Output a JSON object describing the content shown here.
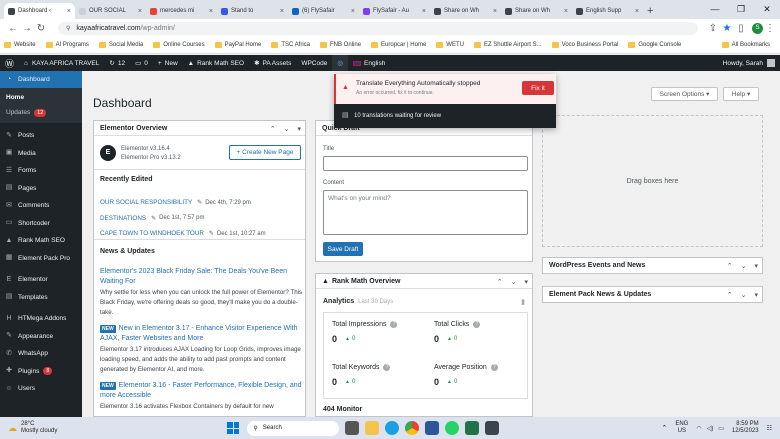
{
  "browser": {
    "tabs": [
      {
        "title": "Dashboard ‹",
        "color": "#3c434a",
        "active": true
      },
      {
        "title": "OUR SOCIAL",
        "color": "#c7d2dc",
        "active": false
      },
      {
        "title": "mercedes mi",
        "color": "#ea4335",
        "active": false
      },
      {
        "title": "Stand to",
        "color": "#3858e9",
        "active": false
      },
      {
        "title": "(6) FlySafair",
        "color": "#0a66c2",
        "active": false
      },
      {
        "title": "FlySafair - Au",
        "color": "#7e3ff2",
        "active": false
      },
      {
        "title": "Share on Wh",
        "color": "#3c434a",
        "active": false
      },
      {
        "title": "Share on Wh",
        "color": "#3c434a",
        "active": false
      },
      {
        "title": "English Supp",
        "color": "#3c434a",
        "active": false
      }
    ],
    "new_tab_symbol": "+",
    "window_controls": [
      "—",
      "❐",
      "✕"
    ],
    "url_host": "kayaafricatravel.com",
    "url_path": "/wp-admin/",
    "profile_initial": "S",
    "bookmarks": [
      "Website",
      "AI Programs",
      "Social Media",
      "Online Courses",
      "PayPal Home",
      "TSC Africa",
      "FNB Online",
      "Europcar | Home",
      "WETU",
      "EZ Shuttle Airport S...",
      "Voco Business Portal",
      "Google Console"
    ],
    "all_bookmarks": "All Bookmarks"
  },
  "adminbar": {
    "site_name": "KAYA AFRICA TRAVEL",
    "updates_count": "12",
    "comments_count": "0",
    "new_label": "New",
    "rankmath_label": "Rank Math SEO",
    "pa_label": "PA Assets",
    "wpcode_label": "WPCode",
    "lang_label": "English",
    "howdy": "Howdy, Sarah"
  },
  "sidebar": {
    "dashboard": "Dashboard",
    "home": "Home",
    "updates": "Updates",
    "updates_badge": "12",
    "items": [
      {
        "label": "Posts",
        "icon": "✎"
      },
      {
        "label": "Media",
        "icon": "▣"
      },
      {
        "label": "Forms",
        "icon": "☰"
      },
      {
        "label": "Pages",
        "icon": "▤"
      },
      {
        "label": "Comments",
        "icon": "✉"
      },
      {
        "label": "Shortcoder",
        "icon": "▭"
      },
      {
        "label": "Rank Math SEO",
        "icon": "▲"
      },
      {
        "label": "Element Pack Pro",
        "icon": "▦"
      }
    ],
    "items2": [
      {
        "label": "Elementor",
        "icon": "E"
      },
      {
        "label": "Templates",
        "icon": "▤"
      }
    ],
    "items3": [
      {
        "label": "HTMega Addons",
        "icon": "H"
      },
      {
        "label": "Appearance",
        "icon": "✎"
      },
      {
        "label": "WhatsApp",
        "icon": "✆"
      },
      {
        "label": "Plugins",
        "icon": "✚",
        "badge": "8"
      },
      {
        "label": "Users",
        "icon": "☺"
      }
    ]
  },
  "page": {
    "title": "Dashboard",
    "screen_options": "Screen Options ▾",
    "help": "Help ▾",
    "drag_boxes": "Drag boxes here"
  },
  "elementor": {
    "title": "Elementor Overview",
    "version1": "Elementor v3.16.4",
    "version2": "Elementor Pro v3.13.2",
    "create_btn": "+ Create New Page",
    "recently_edited": "Recently Edited",
    "recent": [
      {
        "title": "OUR SOCIAL RESPONSIBILITY",
        "date": "Dec 4th, 7:29 pm"
      },
      {
        "title": "DESTINATIONS",
        "date": "Dec 1st, 7:57 pm"
      },
      {
        "title": "CAPE TOWN TO WINDHOEK TOUR",
        "date": "Dec 1st, 10:27 am"
      }
    ],
    "news_title": "News & Updates",
    "news1_title": "Elementor's 2023 Black Friday Sale: The Deals You've Been Waiting For",
    "news1_body": "Why settle for less when you can unlock the full power of Elementor? This Black Friday, we're offering deals so good, they'll make you do a double-take.",
    "new_badge": "NEW",
    "news2_title": "New in Elementor 3.17 - Enhance Visitor Experience With AJAX, Faster Websites and More",
    "news2_body": "Elementor 3.17 introduces AJAX Loading for Loop Grids, improves image loading speed, and adds the ability to add past prompts and content generated by Elementor AI, and more.",
    "news3_title": "Elementor 3.16 - Faster Performance, Flexible Design, and more Accessible",
    "news3_body": "Elementor 3.16 activates Flexbox Containers by default for new"
  },
  "quick_draft": {
    "title": "Quick Draft",
    "title_label": "Title",
    "content_label": "Content",
    "content_placeholder": "What's on your mind?",
    "save_btn": "Save Draft"
  },
  "rankmath": {
    "title": "Rank Math Overview",
    "analytics": "Analytics",
    "period": "Last 30 Days",
    "stats": [
      {
        "label": "Total Impressions",
        "value": "0",
        "delta": "0"
      },
      {
        "label": "Total Clicks",
        "value": "0",
        "delta": "0"
      },
      {
        "label": "Total Keywords",
        "value": "0",
        "delta": "0"
      },
      {
        "label": "Average Position",
        "value": "0",
        "delta": "0"
      }
    ],
    "monitor": "404 Monitor"
  },
  "right_boxes": {
    "events": "WordPress Events and News",
    "ep_news": "Element Pack News & Updates"
  },
  "translate_popup": {
    "title": "Translate Everything Automatically stopped",
    "desc": "An error occurred, fix it to continue.",
    "fix_btn": "Fix it",
    "waiting": "10 translations waiting for review"
  },
  "taskbar": {
    "temp": "28°C",
    "weather": "Mostly cloudy",
    "search": "Search",
    "lang1": "ENG",
    "lang2": "US",
    "time": "8:59 PM",
    "date": "12/5/2023"
  },
  "colors": {
    "wp_dark": "#1d2327",
    "wp_blue": "#2271b1",
    "wp_red": "#d63638",
    "fix_btn": "#d63638"
  }
}
